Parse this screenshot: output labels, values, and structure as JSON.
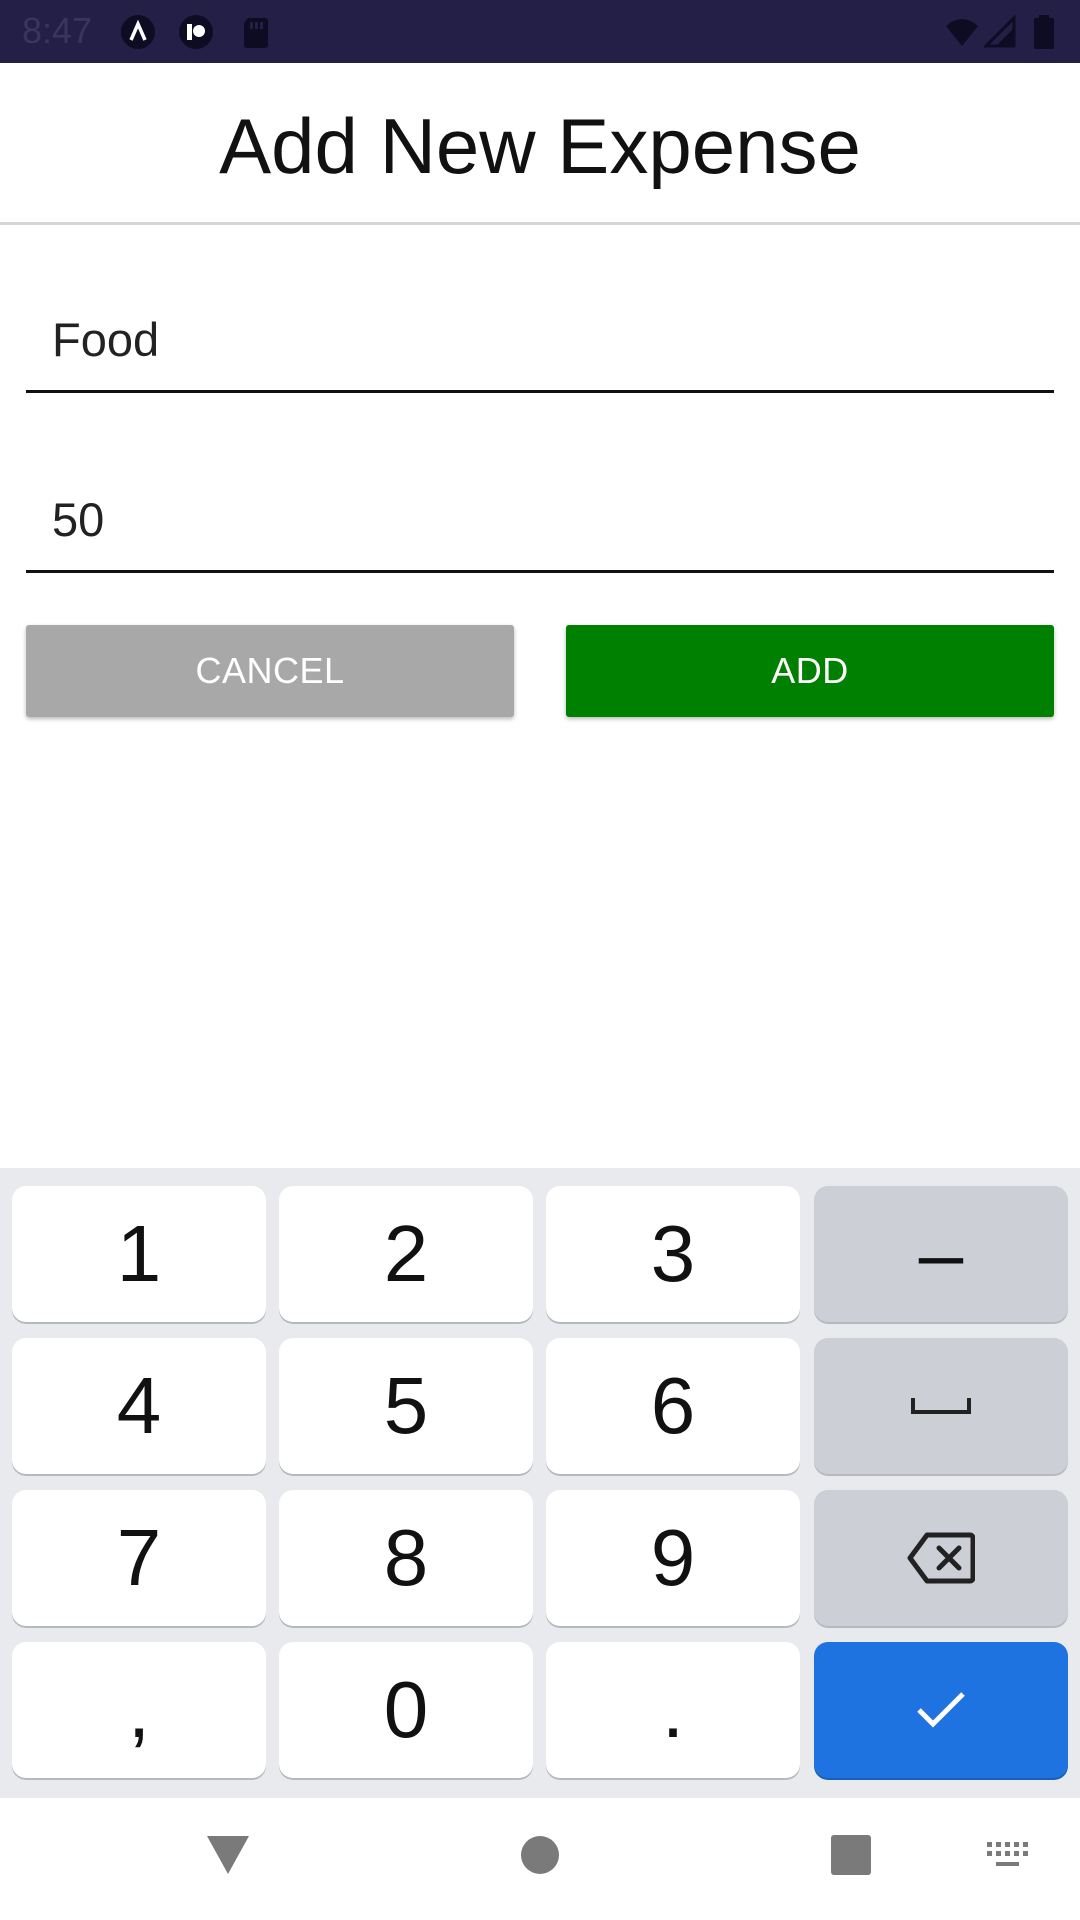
{
  "status_bar": {
    "time": "8:47",
    "icons": [
      "a-badge-icon",
      "assistant-icon",
      "sd-card-icon",
      "wifi-icon",
      "signal-icon",
      "battery-icon"
    ]
  },
  "header": {
    "title": "Add New Expense"
  },
  "form": {
    "category_value": "Food",
    "amount_value": "50"
  },
  "buttons": {
    "cancel_label": "CANCEL",
    "add_label": "ADD",
    "cancel_color": "#a8a8a8",
    "add_color": "#008000"
  },
  "keyboard": {
    "rows": [
      [
        "1",
        "2",
        "3",
        "–"
      ],
      [
        "4",
        "5",
        "6",
        "space"
      ],
      [
        "7",
        "8",
        "9",
        "backspace"
      ],
      [
        ",",
        "0",
        ".",
        "enter"
      ]
    ],
    "keys": {
      "k1": "1",
      "k2": "2",
      "k3": "3",
      "minus": "–",
      "k4": "4",
      "k5": "5",
      "k6": "6",
      "k7": "7",
      "k8": "8",
      "k9": "9",
      "comma": ",",
      "k0": "0",
      "period": "."
    },
    "enter_color": "#1f73e1"
  },
  "nav_bar": {
    "icons": [
      "back-icon",
      "home-icon",
      "recents-icon",
      "keyboard-switch-icon"
    ]
  }
}
